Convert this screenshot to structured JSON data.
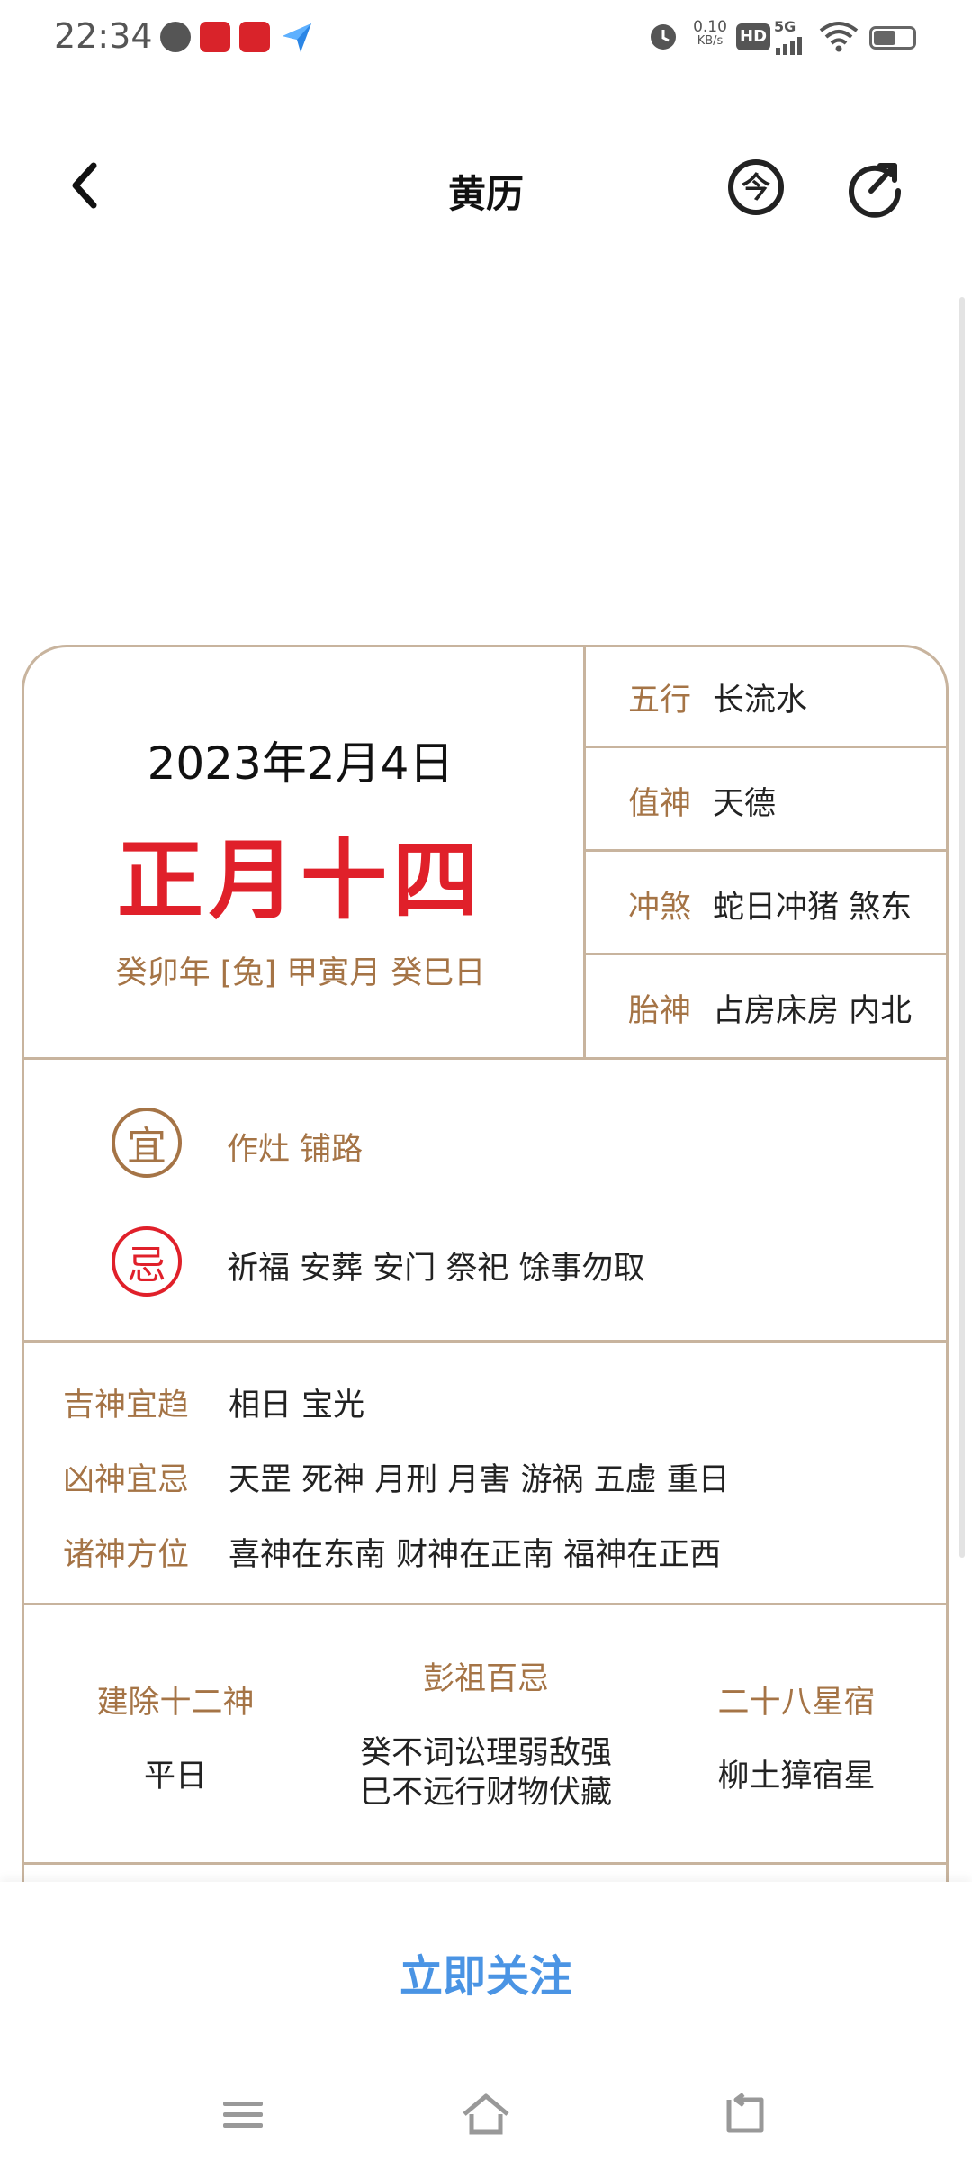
{
  "status_bar": {
    "time": "22:34",
    "net_speed_value": "0.10",
    "net_speed_unit": "KB/s",
    "hd": "HD",
    "signal": "5G",
    "battery_level": 0.55
  },
  "header": {
    "title": "黄历",
    "today_icon_char": "今"
  },
  "date": {
    "solar": "2023年2月4日",
    "lunar": "正月十四",
    "ganzhi": "癸卯年 [兔] 甲寅月 癸巳日"
  },
  "info": [
    {
      "label": "五行",
      "value": "长流水"
    },
    {
      "label": "值神",
      "value": "天德"
    },
    {
      "label": "冲煞",
      "value": "蛇日冲猪 煞东"
    },
    {
      "label": "胎神",
      "value": "占房床房 内北"
    }
  ],
  "yi": {
    "icon": "宜",
    "text": "作灶 铺路",
    "color": "#a57446"
  },
  "ji": {
    "icon": "忌",
    "text": "祈福 安葬 安门 祭祀 馀事勿取",
    "color": "#e0202a"
  },
  "gods": [
    {
      "label": "吉神宜趋",
      "value": "相日 宝光"
    },
    {
      "label": "凶神宜忌",
      "value": "天罡 死神 月刑 月害 游祸 五虚 重日"
    },
    {
      "label": "诸神方位",
      "value": "喜神在东南 财神在正南 福神在正西"
    }
  ],
  "columns": {
    "jianchu": {
      "title": "建除十二神",
      "value": "平日"
    },
    "pengzu": {
      "title": "彭祖百忌",
      "line1": "癸不词讼理弱敌强",
      "line2": "巳不远行财物伏藏"
    },
    "xiu": {
      "title": "二十八星宿",
      "value": "柳土獐宿星"
    }
  },
  "follow_label": "立即关注",
  "colors": {
    "accent_brown": "#a57446",
    "lunar_red": "#e0202a",
    "border": "#c8b49e",
    "follow_blue": "#4a94e4"
  }
}
